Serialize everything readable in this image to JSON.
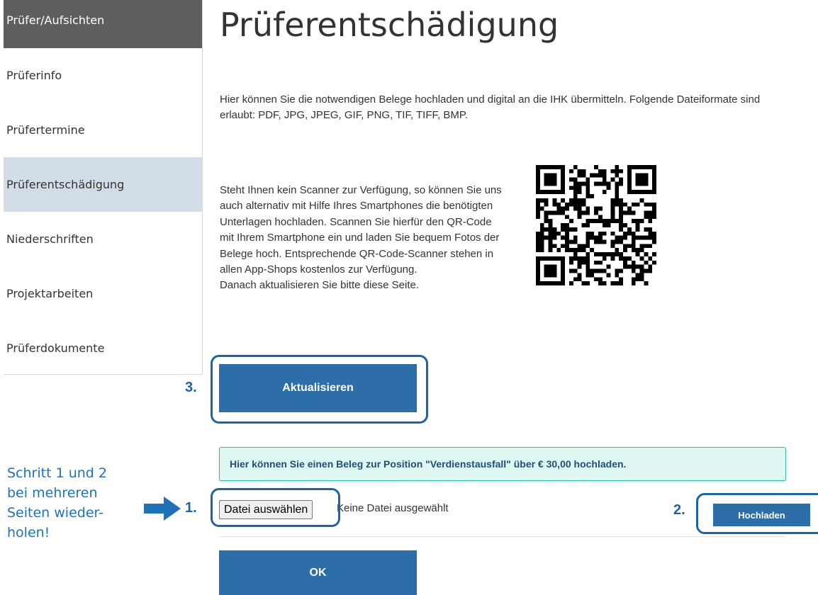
{
  "sidebar": {
    "header": "Prüfer/Aufsichten",
    "items": [
      {
        "label": "Prüferinfo"
      },
      {
        "label": "Prüfertermine"
      },
      {
        "label": "Prüferentschädigung"
      },
      {
        "label": "Niederschriften"
      },
      {
        "label": "Projektarbeiten"
      },
      {
        "label": "Prüferdokumente"
      }
    ],
    "active_index": 2
  },
  "main": {
    "title": "Prüferentschädigung",
    "intro": "Hier können Sie die notwendigen Belege hochladen und digital an die IHK übermitteln. Folgende Dateiformate sind erlaubt: PDF, JPG, JPEG, GIF, PNG, TIF, TIFF, BMP.",
    "scanner_text": "Steht Ihnen kein Scanner zur Verfügung, so können Sie uns auch alternativ mit Hilfe Ihres Smartphones die benötigten Unterlagen hochladen. Scannen Sie hierfür den QR-Code mit Ihrem Smartphone ein und laden Sie bequem Fotos der Belege hoch. Entsprechende QR-Code-Scanner stehen in allen App-Shops kostenlos zur Verfügung.",
    "refresh_hint": "Danach aktualisieren Sie bitte diese Seite.",
    "refresh_button": "Aktualisieren",
    "info_message": "Hier können Sie einen Beleg zur Position \"Verdienstausfall\" über € 30,00 hochladen.",
    "file_button": "Datei auswählen",
    "file_status": "Keine Datei ausgewählt",
    "upload_button": "Hochladen",
    "ok_button": "OK"
  },
  "annotations": {
    "step1": "1.",
    "step2": "2.",
    "step3": "3.",
    "note_lines": [
      "Schritt 1 und 2",
      "bei mehreren",
      "Seiten wieder-",
      "holen!"
    ],
    "accent_color": "#1f63a4"
  },
  "colors": {
    "primary_button": "#2d6ea8",
    "sidebar_header": "#5e5e5e",
    "sidebar_active": "#d2dde7",
    "info_bg": "#dff7f3",
    "info_border": "#3ab7a6"
  }
}
